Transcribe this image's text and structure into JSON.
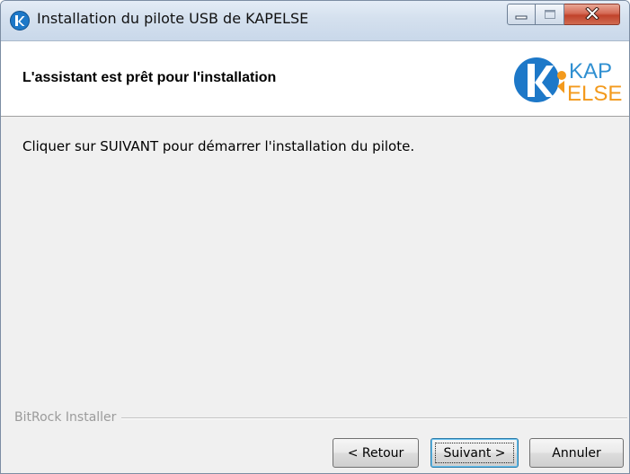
{
  "window": {
    "title": "Installation du pilote USB de KAPELSE",
    "controls": {
      "minimize": "minimize",
      "maximize": "maximize",
      "close": "close"
    }
  },
  "header": {
    "title": "L'assistant est prêt pour l'installation",
    "logo": {
      "text_top": "KAP",
      "text_bottom": "ELSE",
      "colors": {
        "blue": "#1d78c8",
        "orange": "#f39a1d",
        "text": "#2f8fd1"
      }
    }
  },
  "body": {
    "message": "Cliquer sur SUIVANT pour démarrer l'installation du pilote."
  },
  "footer": {
    "installer_label": "BitRock Installer",
    "buttons": {
      "back": "< Retour",
      "next": "Suivant >",
      "cancel": "Annuler"
    }
  }
}
